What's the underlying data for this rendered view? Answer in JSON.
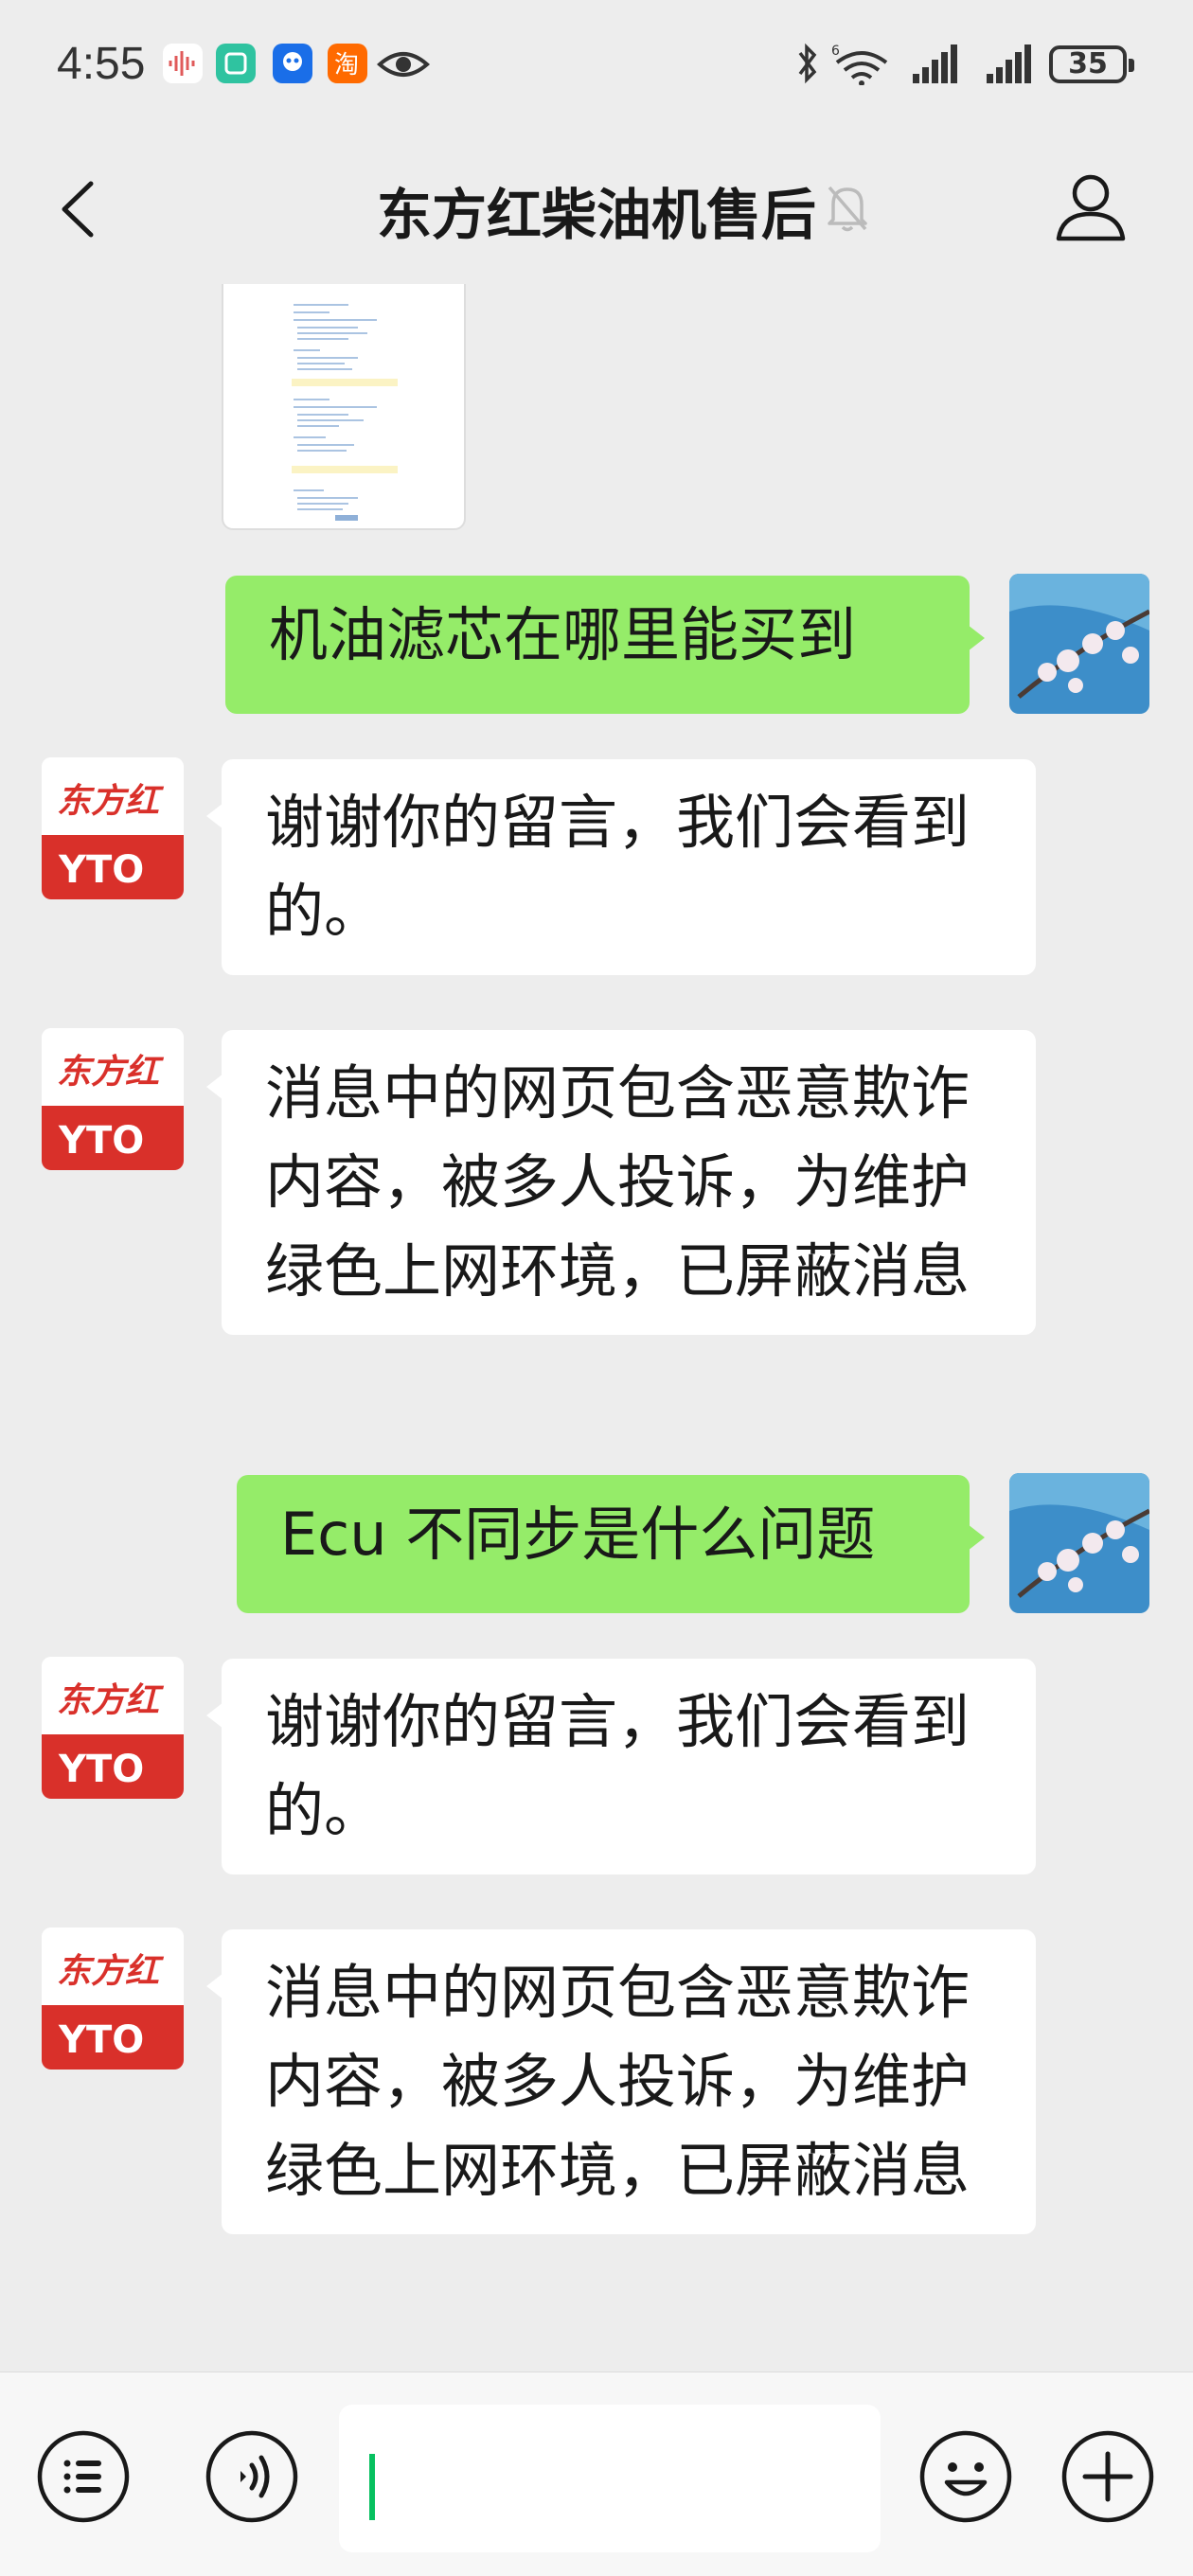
{
  "status_bar": {
    "time": "4:55",
    "battery": "35",
    "icons": [
      "audio-wave-icon",
      "mi-home-icon",
      "ai-assistant-icon",
      "taobao-icon",
      "eye-icon",
      "bluetooth-icon",
      "wifi-icon",
      "signal-icon",
      "signal-icon",
      "battery-icon"
    ]
  },
  "header": {
    "title": "东方红柴油机售后",
    "muted": true
  },
  "messages": [
    {
      "side": "right",
      "type": "text",
      "text": "机油滤芯在哪里能买到"
    },
    {
      "side": "left",
      "type": "text",
      "text": "谢谢你的留言，我们会看到的。"
    },
    {
      "side": "left",
      "type": "text",
      "text": "消息中的网页包含恶意欺诈内容，被多人投诉，为维护绿色上网环境，已屏蔽消息"
    },
    {
      "side": "right",
      "type": "text",
      "text": "Ecu 不同步是什么问题"
    },
    {
      "side": "left",
      "type": "text",
      "text": "谢谢你的留言，我们会看到的。"
    },
    {
      "side": "left",
      "type": "text",
      "text": "消息中的网页包含恶意欺诈内容，被多人投诉，为维护绿色上网环境，已屏蔽消息"
    }
  ],
  "bot_avatar": {
    "top_text": "东方红",
    "bottom_text": "YTO",
    "color": "#d9302a"
  },
  "colors": {
    "sent_bubble": "#95ec69",
    "received_bubble": "#ffffff",
    "background": "#ededed",
    "caret": "#07c160"
  },
  "input_bar": {
    "value": "",
    "icons": [
      "menu-icon",
      "voice-icon",
      "emoji-icon",
      "plus-icon"
    ]
  }
}
